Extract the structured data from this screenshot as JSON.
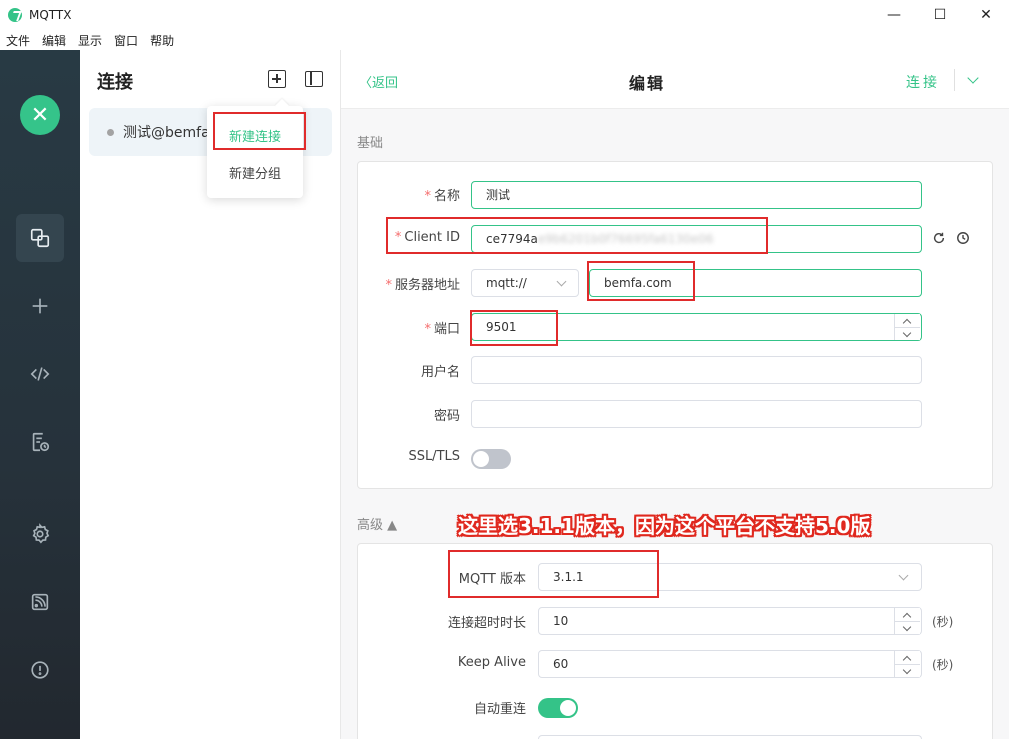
{
  "window": {
    "title": "MQTTX",
    "minimize": "—",
    "maximize": "☐",
    "close": "✕"
  },
  "menu": [
    "文件",
    "编辑",
    "显示",
    "窗口",
    "帮助"
  ],
  "nav": {
    "logo": "✕"
  },
  "connections": {
    "title": "连接",
    "items": [
      {
        "name": "测试@bemfa"
      }
    ],
    "popup": {
      "new_connection": "新建连接",
      "new_group": "新建分组"
    }
  },
  "edit": {
    "back": "返回",
    "title": "编辑",
    "connect": "连接",
    "basic": {
      "section": "基础",
      "name_label": "名称",
      "name_value": "测试",
      "client_id_label": "Client ID",
      "client_id_visible": "ce7794a",
      "client_id_blurred": "e9b6201b0f76695fa6130e06",
      "host_label": "服务器地址",
      "protocol_value": "mqtt://",
      "host_value": "bemfa.com",
      "port_label": "端口",
      "port_value": "9501",
      "username_label": "用户名",
      "username_value": "",
      "password_label": "密码",
      "password_value": "",
      "ssl_label": "SSL/TLS",
      "ssl_enabled": false
    },
    "advanced": {
      "section": "高级",
      "mqtt_version_label": "MQTT 版本",
      "mqtt_version_value": "3.1.1",
      "timeout_label": "连接超时时长",
      "timeout_value": "10",
      "timeout_unit": "(秒)",
      "keepalive_label": "Keep Alive",
      "keepalive_value": "60",
      "keepalive_unit": "(秒)",
      "reconnect_label": "自动重连",
      "reconnect_enabled": true
    }
  },
  "annotation": "这里选3.1.1版本，因为这个平台不支持5.0版",
  "colors": {
    "accent": "#34c388",
    "highlight": "#e02b2b",
    "nav_bg": "#283a44"
  }
}
